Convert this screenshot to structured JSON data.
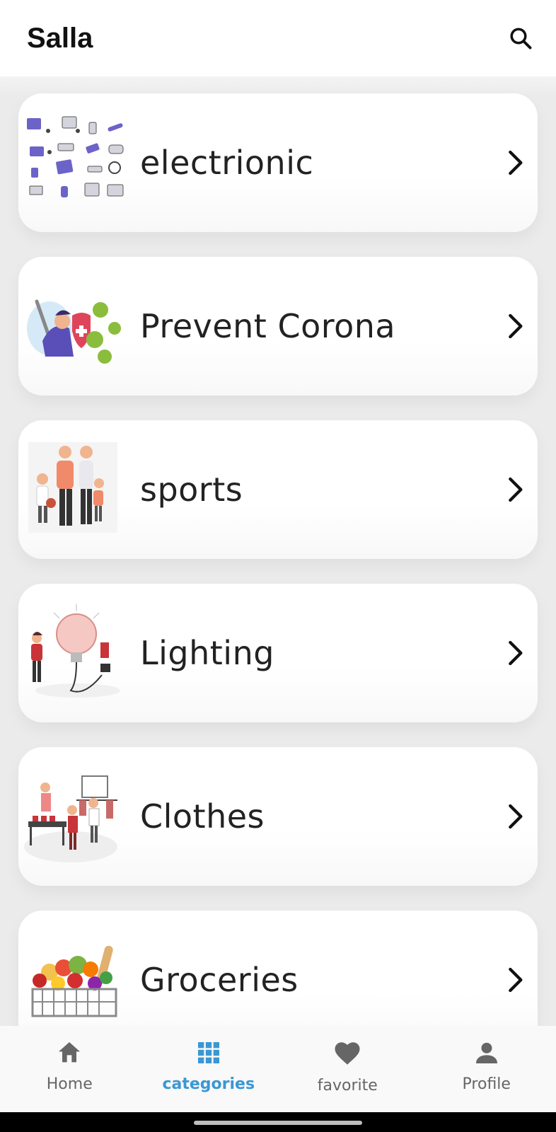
{
  "app": {
    "title": "Salla"
  },
  "search": {
    "icon": "search-icon"
  },
  "categories": [
    {
      "label": "electrionic",
      "image": "electronics-illustration"
    },
    {
      "label": "Prevent Corona",
      "image": "corona-prevention-illustration"
    },
    {
      "label": "sports",
      "image": "family-sports-illustration"
    },
    {
      "label": "Lighting",
      "image": "lightbulb-illustration"
    },
    {
      "label": "Clothes",
      "image": "clothing-store-illustration"
    },
    {
      "label": "Groceries",
      "image": "grocery-basket-illustration"
    }
  ],
  "nav": {
    "items": [
      {
        "label": "Home",
        "icon": "home-icon"
      },
      {
        "label": "categories",
        "icon": "grid-icon"
      },
      {
        "label": "favorite",
        "icon": "heart-icon"
      },
      {
        "label": "Profile",
        "icon": "person-icon"
      }
    ],
    "active": "categories",
    "active_color": "#3b97d3",
    "inactive_color": "#666666"
  }
}
